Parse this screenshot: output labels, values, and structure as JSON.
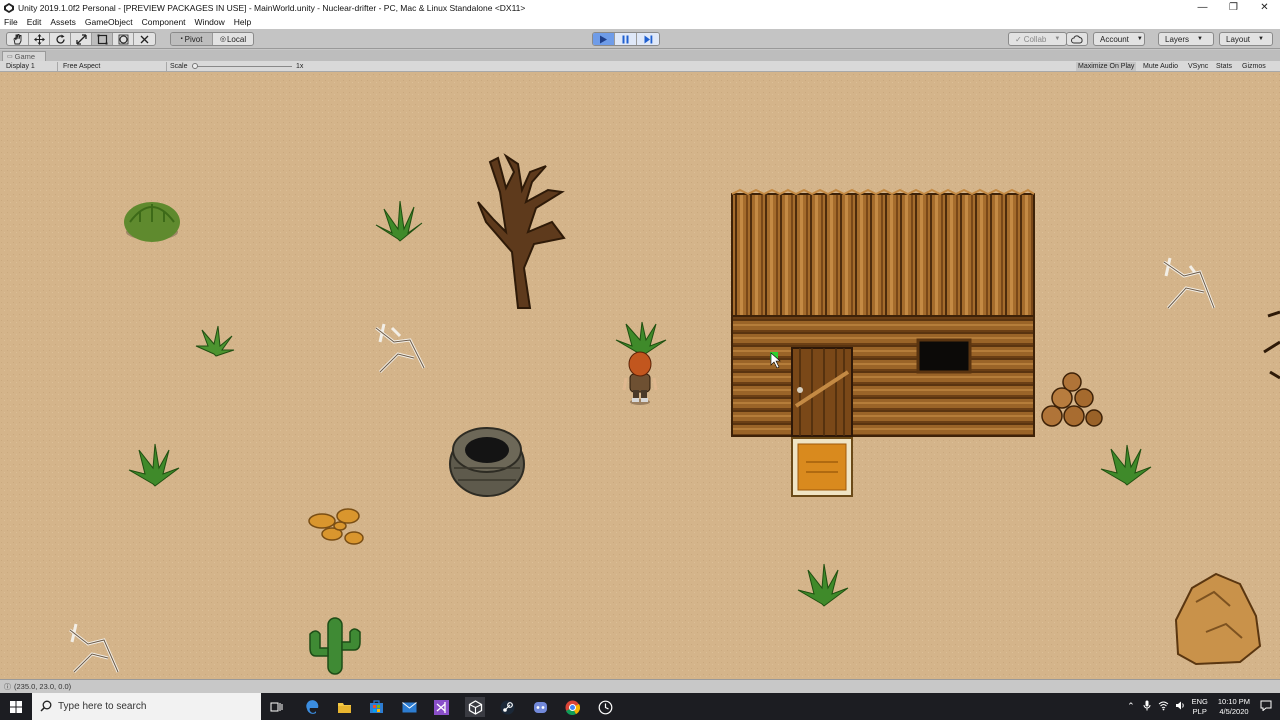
{
  "window": {
    "title": "Unity 2019.1.0f2 Personal - [PREVIEW PACKAGES IN USE] - MainWorld.unity - Nuclear-drifter - PC, Mac & Linux Standalone <DX11>",
    "minimize": "—",
    "maximize": "❐",
    "close": "✕"
  },
  "menu": [
    "File",
    "Edit",
    "Assets",
    "GameObject",
    "Component",
    "Window",
    "Help"
  ],
  "toolbar": {
    "pivot": "Pivot",
    "local": "Local",
    "collab": "Collab",
    "account": "Account",
    "layers": "Layers",
    "layout": "Layout",
    "play_state": "playing"
  },
  "game_tab": {
    "label": "Game"
  },
  "game_bar": {
    "display": "Display 1",
    "aspect": "Free Aspect",
    "scale_label": "Scale",
    "scale_value": "1x",
    "maximize_on_play": "Maximize On Play",
    "mute_audio": "Mute Audio",
    "vsync": "VSync",
    "stats": "Stats",
    "gizmos": "Gizmos"
  },
  "status": {
    "text": "(235.0, 23.0, 0.0)"
  },
  "taskbar": {
    "search_placeholder": "Type here to search",
    "lang_top": "ENG",
    "lang_bottom": "PLP",
    "time": "10:10 PM",
    "date": "4/5/2020"
  },
  "colors": {
    "sand": "#d4b48a",
    "wood": "#8a5a24",
    "play_blue": "#6f9ce8",
    "taskbar": "#1c1d22"
  },
  "icons": [
    "unity-icon",
    "hand-tool-icon",
    "move-tool-icon",
    "rotate-tool-icon",
    "scale-tool-icon",
    "rect-tool-icon",
    "transform-tool-icon",
    "custom-tool-icon",
    "play-icon",
    "pause-icon",
    "step-icon",
    "cloud-icon",
    "windows-start-icon",
    "search-icon",
    "task-view-icon",
    "edge-icon",
    "explorer-icon",
    "store-icon",
    "mail-icon",
    "vs-icon",
    "unity-taskbar-icon",
    "steam-icon",
    "discord-icon",
    "chrome-icon",
    "clock-app-icon"
  ]
}
